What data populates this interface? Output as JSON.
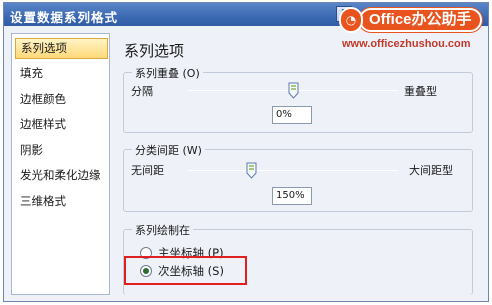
{
  "window": {
    "title": "设置数据系列格式",
    "help_icon": "?"
  },
  "watermark": {
    "logo_glyph": "◔",
    "brand": "Office办公助手",
    "url": "www.officezhushou.com"
  },
  "sidebar": {
    "items": [
      {
        "label": "系列选项",
        "selected": true
      },
      {
        "label": "填充"
      },
      {
        "label": "边框颜色"
      },
      {
        "label": "边框样式"
      },
      {
        "label": "阴影"
      },
      {
        "label": "发光和柔化边缘"
      },
      {
        "label": "三维格式"
      }
    ]
  },
  "main": {
    "title": "系列选项",
    "overlap": {
      "label": "系列重叠 (O)",
      "left": "分隔",
      "right": "重叠型",
      "value": "0%",
      "level_fraction": 0.5
    },
    "gap": {
      "label": "分类间距 (W)",
      "left": "无间距",
      "right": "大间距型",
      "value": "150%",
      "level_fraction": 0.3
    },
    "plot_on": {
      "label": "系列绘制在",
      "options": [
        {
          "label": "主坐标轴 (P)",
          "checked": false
        },
        {
          "label": "次坐标轴 (S)",
          "checked": true
        }
      ]
    }
  },
  "colors": {
    "title_bar": "#3e6cb4",
    "selected_item": "#ffd97a",
    "highlight": "#e02020",
    "watermark": "#e8531e"
  }
}
